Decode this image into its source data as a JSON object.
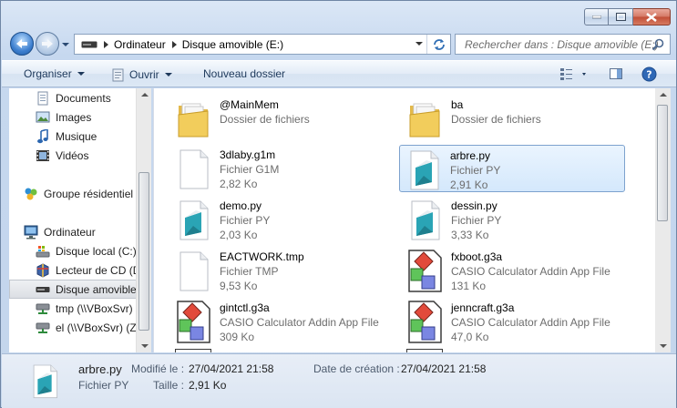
{
  "window": {
    "minimize": "minimize",
    "maximize": "maximize",
    "close": "close"
  },
  "address": {
    "drive_icon": "drive-icon",
    "crumbs": [
      "Ordinateur",
      "Disque amovible (E:)"
    ]
  },
  "search": {
    "placeholder": "Rechercher dans : Disque amovible (E:)"
  },
  "toolbar": {
    "organize": "Organiser",
    "open": "Ouvrir",
    "new_folder": "Nouveau dossier"
  },
  "sidebar": {
    "items": [
      {
        "label": "Documents",
        "icon": "documents-icon"
      },
      {
        "label": "Images",
        "icon": "images-icon"
      },
      {
        "label": "Musique",
        "icon": "music-icon"
      },
      {
        "label": "Vidéos",
        "icon": "videos-icon"
      },
      {
        "label": "Groupe résidentiel",
        "icon": "homegroup-icon"
      },
      {
        "label": "Ordinateur",
        "icon": "computer-icon"
      },
      {
        "label": "Disque local (C:)",
        "icon": "local-disk-icon"
      },
      {
        "label": "Lecteur de CD (D",
        "icon": "cd-drive-icon"
      },
      {
        "label": "Disque amovible",
        "icon": "removable-drive-icon"
      },
      {
        "label": "tmp (\\\\VBoxSvr)",
        "icon": "network-drive-icon"
      },
      {
        "label": "el (\\\\VBoxSvr) (Z:",
        "icon": "network-drive-icon"
      }
    ]
  },
  "files": [
    {
      "name": "@MainMem",
      "type": "Dossier de fichiers",
      "size": "",
      "icon": "folder-icon"
    },
    {
      "name": "ba",
      "type": "Dossier de fichiers",
      "size": "",
      "icon": "folder-icon"
    },
    {
      "name": "3dlaby.g1m",
      "type": "Fichier G1M",
      "size": "2,82 Ko",
      "icon": "blank-file-icon"
    },
    {
      "name": "arbre.py",
      "type": "Fichier PY",
      "size": "2,91 Ko",
      "icon": "py-file-icon"
    },
    {
      "name": "demo.py",
      "type": "Fichier PY",
      "size": "2,03 Ko",
      "icon": "py-file-icon"
    },
    {
      "name": "dessin.py",
      "type": "Fichier PY",
      "size": "3,33 Ko",
      "icon": "py-file-icon"
    },
    {
      "name": "EACTWORK.tmp",
      "type": "Fichier TMP",
      "size": "9,53 Ko",
      "icon": "blank-file-icon"
    },
    {
      "name": "fxboot.g3a",
      "type": "CASIO Calculator Addin App File",
      "size": "131 Ko",
      "icon": "g3a-file-icon"
    },
    {
      "name": "gintctl.g3a",
      "type": "CASIO Calculator Addin App File",
      "size": "309 Ko",
      "icon": "g3a-file-icon"
    },
    {
      "name": "jenncraft.g3a",
      "type": "CASIO Calculator Addin App File",
      "size": "47,0 Ko",
      "icon": "g3a-file-icon"
    }
  ],
  "details": {
    "name": "arbre.py",
    "type": "Fichier PY",
    "modified_label": "Modifié le :",
    "modified_value": "27/04/2021 21:58",
    "created_label": "Date de création :",
    "created_value": "27/04/2021 21:58",
    "size_label": "Taille :",
    "size_value": "2,91 Ko"
  },
  "colors": {
    "accent": "#1e395b",
    "selection": "#d4e8fc",
    "selection_border": "#7da2ce"
  }
}
